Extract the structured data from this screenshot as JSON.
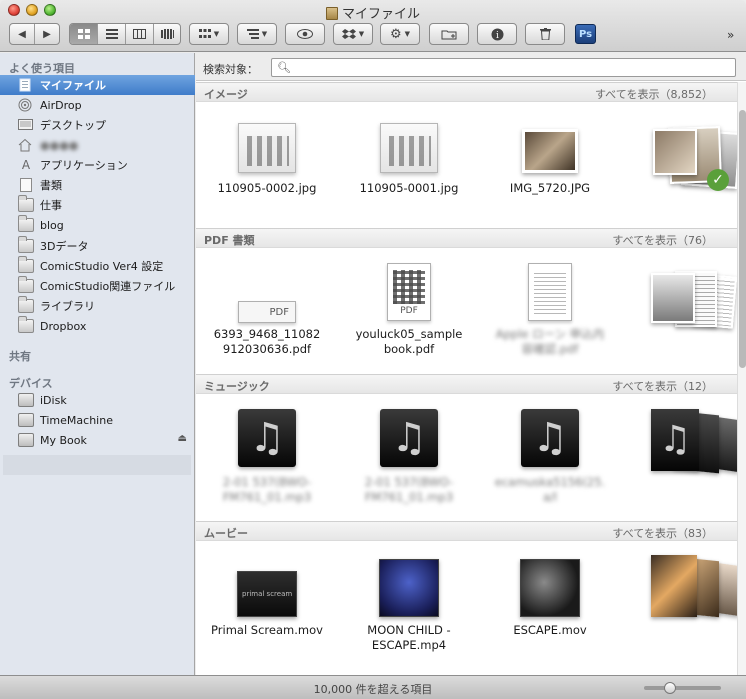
{
  "window": {
    "title": "マイファイル"
  },
  "toolbar": {
    "ps_label": "Ps",
    "overflow": "»"
  },
  "sidebar": {
    "sections": {
      "favorites": "よく使う項目",
      "shared": "共有",
      "devices": "デバイス"
    },
    "favorites": [
      {
        "label": "マイファイル",
        "icon": "all-my-files-icon",
        "selected": true
      },
      {
        "label": "AirDrop",
        "icon": "airdrop-icon"
      },
      {
        "label": "デスクトップ",
        "icon": "desktop-icon"
      },
      {
        "label": "●●●●",
        "icon": "home-icon",
        "blurred": true
      },
      {
        "label": "アプリケーション",
        "icon": "applications-icon"
      },
      {
        "label": "書類",
        "icon": "documents-icon"
      },
      {
        "label": "仕事",
        "icon": "folder-icon"
      },
      {
        "label": "blog",
        "icon": "folder-icon"
      },
      {
        "label": "3Dデータ",
        "icon": "folder-icon"
      },
      {
        "label": "ComicStudio Ver4 設定",
        "icon": "folder-icon"
      },
      {
        "label": "ComicStudio関連ファイル",
        "icon": "folder-icon"
      },
      {
        "label": "ライブラリ",
        "icon": "folder-icon"
      },
      {
        "label": "Dropbox",
        "icon": "folder-icon"
      }
    ],
    "devices": [
      {
        "label": "iDisk",
        "icon": "idisk-icon"
      },
      {
        "label": "TimeMachine",
        "icon": "drive-icon"
      },
      {
        "label": "My Book",
        "icon": "drive-icon",
        "eject": "⏏"
      }
    ]
  },
  "search": {
    "label": "検索対象：",
    "value": ""
  },
  "sections": [
    {
      "title": "イメージ",
      "show_all": "すべてを表示（8,852）",
      "items": [
        "110905-0002.jpg",
        "110905-0001.jpg",
        "IMG_5720.JPG"
      ]
    },
    {
      "title": "PDF 書類",
      "show_all": "すべてを表示（76）",
      "items": [
        "6393_9468_11082912030636.pdf",
        "youluck05_samplebook.pdf",
        "Apple ローン 申込内容確認.pdf"
      ],
      "captions": [
        [
          "6393_9468_11082",
          "912030636.pdf"
        ],
        [
          "youluck05_sample",
          "book.pdf"
        ],
        [
          "Apple ローン 申込内",
          "容確認.pdf"
        ]
      ],
      "pdf_badge": "PDF"
    },
    {
      "title": "ミュージック",
      "show_all": "すべてを表示（12）",
      "captions": [
        [
          "2-01 537(BWO-",
          "FM761_01.mp3"
        ],
        [
          "2-01 537(BWO-",
          "FM761_01.mp3"
        ],
        [
          "ecamuska5156(25.",
          "a/l"
        ]
      ]
    },
    {
      "title": "ムービー",
      "show_all": "すべてを表示（83）",
      "captions": [
        [
          "Primal Scream.mov"
        ],
        [
          "MOON CHILD -",
          "ESCAPE.mp4"
        ],
        [
          "ESCAPE.mov"
        ]
      ],
      "movie_text": "primal scream"
    }
  ],
  "status": {
    "text": "10,000 件を超える項目",
    "zoom_level": 0.3
  },
  "colors": {
    "selection": "#3f7cc9",
    "sidebar_bg": "#e1e6ee"
  }
}
